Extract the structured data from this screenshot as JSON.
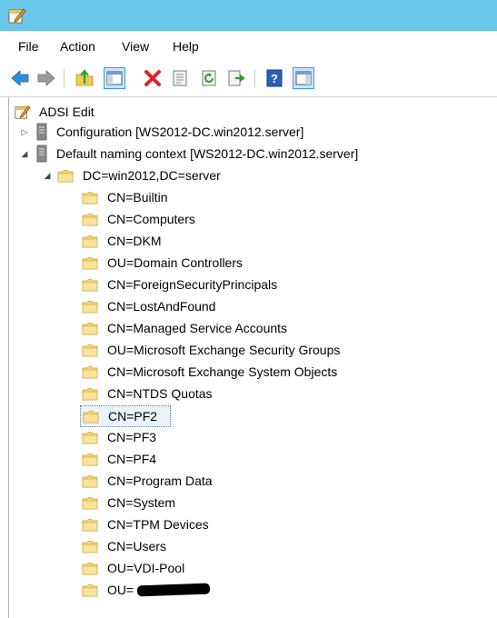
{
  "menu": {
    "file": "File",
    "action": "Action",
    "view": "View",
    "help": "Help"
  },
  "toolbar": {
    "buttons": [
      "back-icon",
      "forward-icon",
      "up-folder-icon",
      "show-hide-tree-icon",
      "delete-icon",
      "properties-icon",
      "refresh-icon",
      "export-list-icon",
      "help-icon",
      "show-hide-action-pane-icon"
    ]
  },
  "tree": {
    "root": "ADSI Edit",
    "configuration": "Configuration [WS2012-DC.win2012.server]",
    "default_context": "Default naming context [WS2012-DC.win2012.server]",
    "domain": "DC=win2012,DC=server",
    "children": [
      "CN=Builtin",
      "CN=Computers",
      "CN=DKM",
      "OU=Domain Controllers",
      "CN=ForeignSecurityPrincipals",
      "CN=LostAndFound",
      "CN=Managed Service Accounts",
      "OU=Microsoft Exchange Security Groups",
      "CN=Microsoft Exchange System Objects",
      "CN=NTDS Quotas",
      "CN=PF2",
      "CN=PF3",
      "CN=PF4",
      "CN=Program Data",
      "CN=System",
      "CN=TPM Devices",
      "CN=Users",
      "OU=VDI-Pool",
      "OU="
    ],
    "selected": "CN=PF2"
  },
  "colors": {
    "titlebar": "#6bc6ec",
    "folder": "#f7d774",
    "selection_border": "#5a7fa6"
  }
}
